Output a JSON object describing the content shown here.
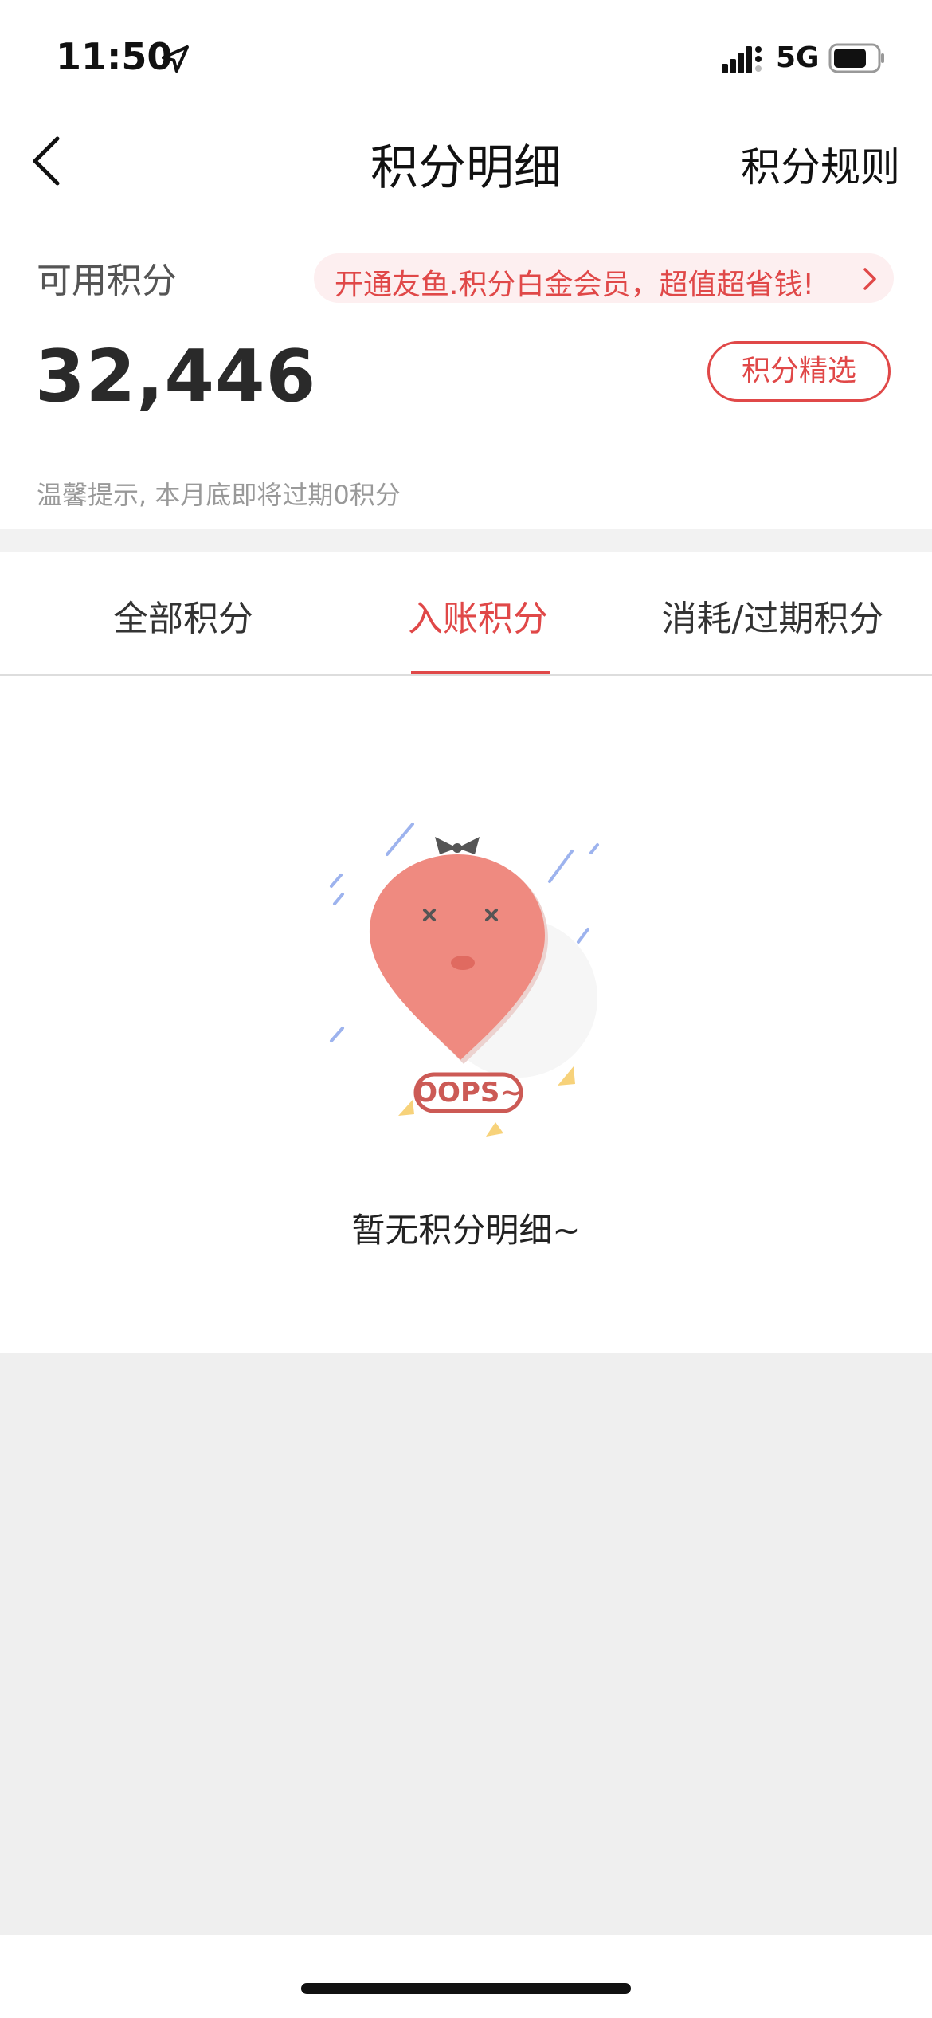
{
  "status_bar": {
    "time": "11:50",
    "network": "5G"
  },
  "nav": {
    "title": "积分明细",
    "right_link": "积分规则"
  },
  "points_card": {
    "label": "可用积分",
    "balance": "32,446",
    "promo_text": "开通友鱼.积分白金会员，超值超省钱!",
    "select_button": "积分精选",
    "tip": "温馨提示, 本月底即将过期0积分"
  },
  "tabs": [
    {
      "label": "全部积分",
      "active": false
    },
    {
      "label": "入账积分",
      "active": true
    },
    {
      "label": "消耗/过期积分",
      "active": false
    }
  ],
  "empty_state": {
    "illustration_text": "OOPS~",
    "message": "暂无积分明细~"
  },
  "colors": {
    "accent": "#e04848",
    "promo_bg": "#fdeff0",
    "page_gray": "#efefef"
  },
  "icons": [
    "location-arrow-icon",
    "signal-icon",
    "battery-icon",
    "back-chevron-icon",
    "chevron-right-icon"
  ]
}
